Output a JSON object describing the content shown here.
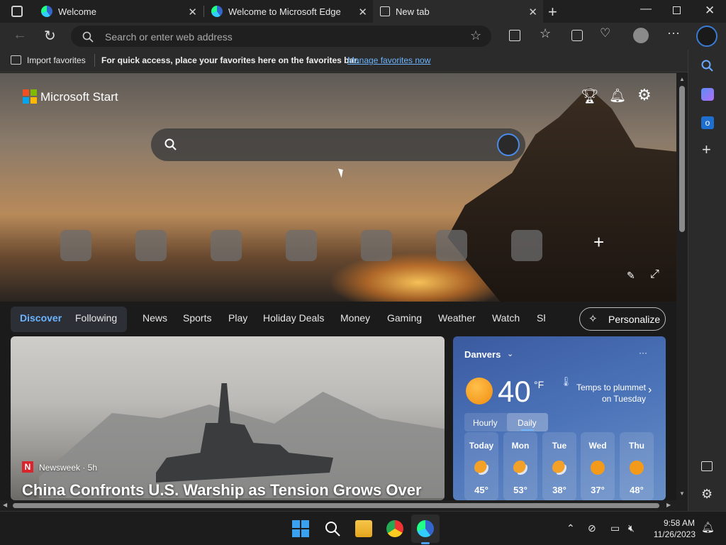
{
  "colors": {
    "accent": "#4aa0f0",
    "link": "#6cb4ff",
    "tab_active_bg": "#2b2b2b",
    "toolbar_bg": "#2b2b2b",
    "weather_bg": "#4b73b8",
    "sun": "#f39a1a"
  },
  "tabs": [
    {
      "title": "Welcome",
      "icon": "edge-icon"
    },
    {
      "title": "Welcome to Microsoft Edge",
      "icon": "edge-icon"
    },
    {
      "title": "New tab",
      "icon": "new-tab-icon",
      "active": true
    }
  ],
  "toolbar": {
    "address_placeholder": "Search or enter web address"
  },
  "favbar": {
    "import_label": "Import favorites",
    "message": "For quick access, place your favorites here on the favorites bar.",
    "manage_link": "Manage favorites now"
  },
  "page": {
    "brand": "Microsoft Start",
    "search_query": ""
  },
  "nav": {
    "tabs": [
      "Discover",
      "Following",
      "News",
      "Sports",
      "Play",
      "Holiday Deals",
      "Money",
      "Gaming",
      "Weather",
      "Watch",
      "Sh"
    ],
    "active": "Discover",
    "personalize_label": "Personalize"
  },
  "news": {
    "source_badge": "N",
    "source": "Newsweek · 5h",
    "headline": "China Confronts U.S. Warship as Tension Grows Over"
  },
  "weather": {
    "location": "Danvers",
    "temp": "40",
    "unit": "°F",
    "alert": "Temps to plummet on Tuesday",
    "tab_hourly": "Hourly",
    "tab_daily": "Daily",
    "more": "···",
    "days": [
      {
        "name": "Today",
        "temp": "45°",
        "icon": "partly-cloudy-icon"
      },
      {
        "name": "Mon",
        "temp": "53°",
        "icon": "partly-cloudy-icon"
      },
      {
        "name": "Tue",
        "temp": "38°",
        "icon": "partly-cloudy-icon"
      },
      {
        "name": "Wed",
        "temp": "37°",
        "icon": "sunny-icon"
      },
      {
        "name": "Thu",
        "temp": "48°",
        "icon": "sunny-icon"
      }
    ]
  },
  "taskbar": {
    "time": "9:58 AM",
    "date": "11/26/2023"
  }
}
